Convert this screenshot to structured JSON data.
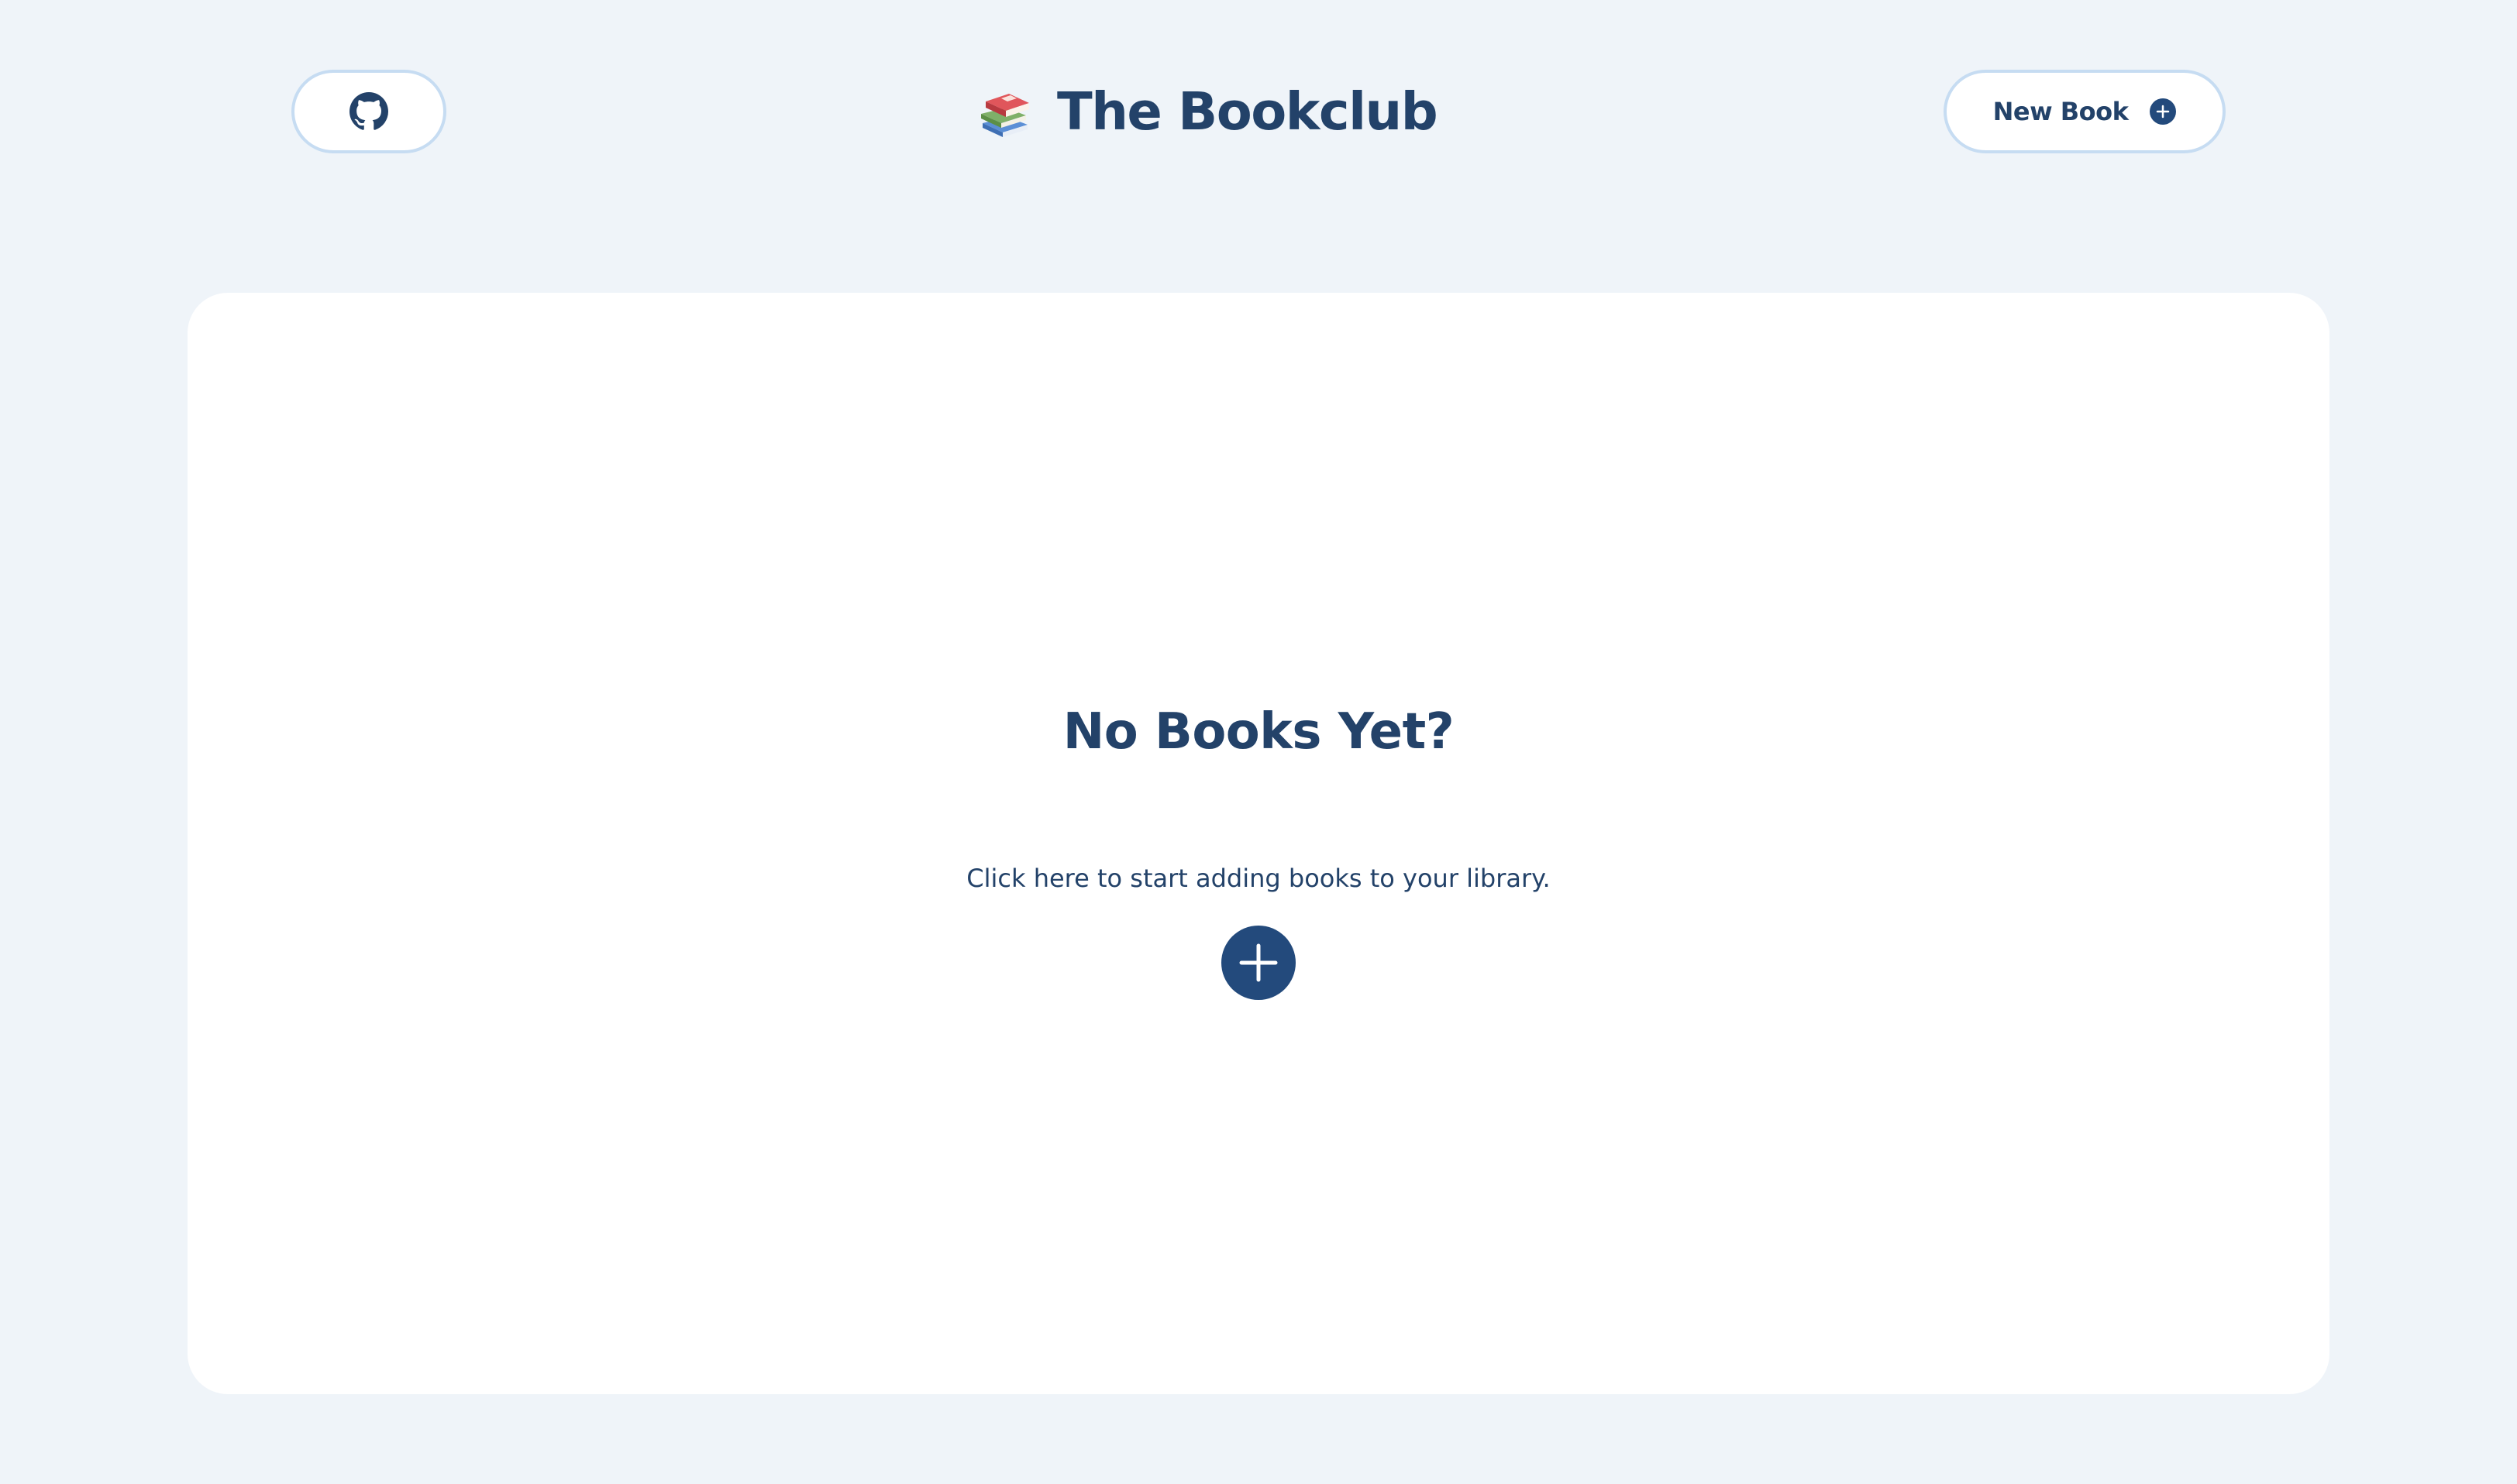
{
  "header": {
    "github_icon": "github-icon",
    "brand_icon": "books-stack-icon",
    "title": "The Bookclub",
    "new_book_label": "New Book",
    "new_book_icon": "plus-circle-icon"
  },
  "main": {
    "empty_title": "No Books Yet?",
    "empty_text": "Click here to start adding books to your library.",
    "add_icon": "plus-circle-icon"
  },
  "colors": {
    "background": "#eff4f9",
    "card": "#ffffff",
    "text": "#234269",
    "accent": "#234a7c",
    "button_border": "#c6dcf2"
  }
}
